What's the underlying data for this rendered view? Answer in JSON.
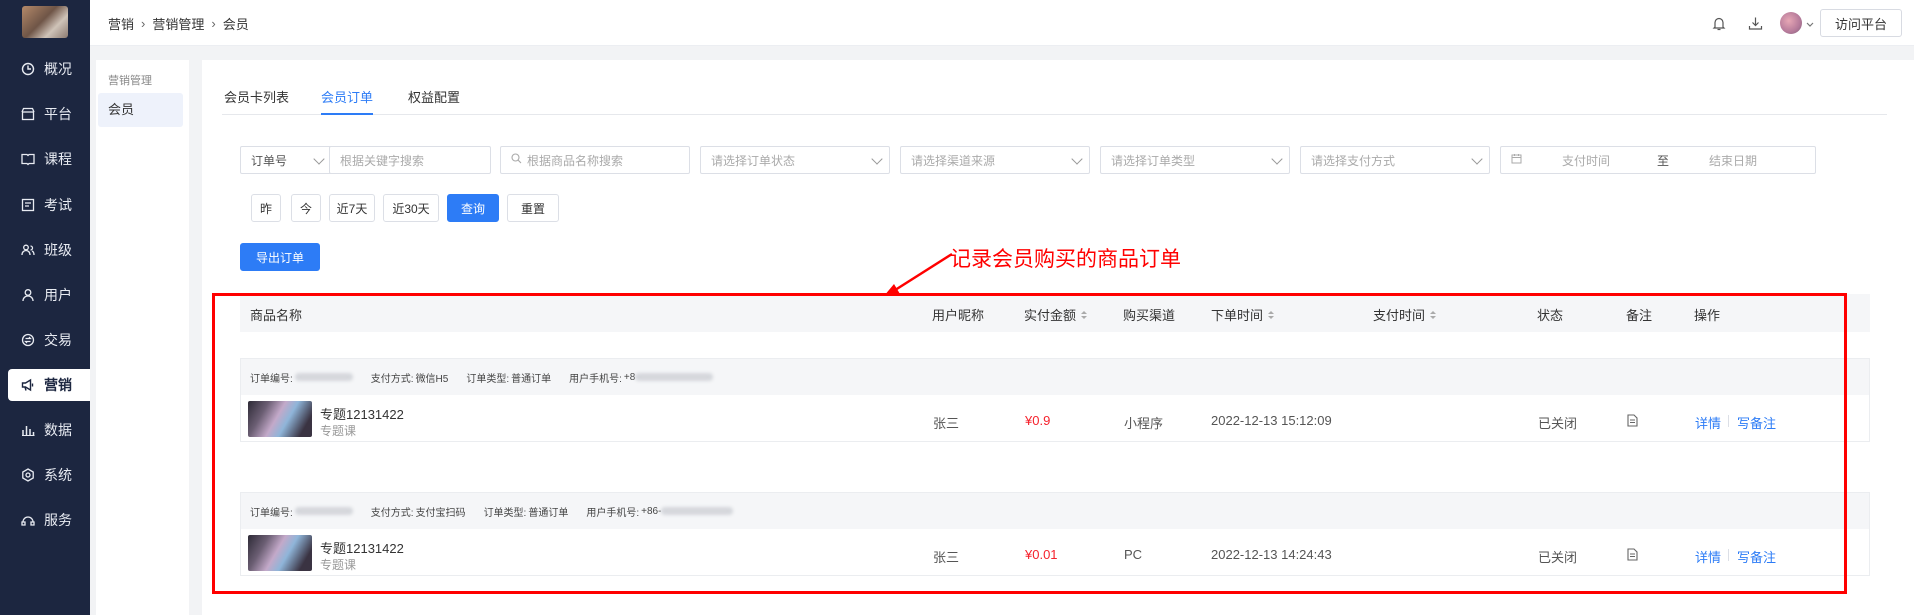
{
  "nav": {
    "items": [
      {
        "label": "概况",
        "icon": "clock-icon"
      },
      {
        "label": "平台",
        "icon": "store-icon"
      },
      {
        "label": "课程",
        "icon": "book-icon"
      },
      {
        "label": "考试",
        "icon": "exam-icon"
      },
      {
        "label": "班级",
        "icon": "class-icon"
      },
      {
        "label": "用户",
        "icon": "user-icon"
      },
      {
        "label": "交易",
        "icon": "trade-icon"
      },
      {
        "label": "营销",
        "icon": "megaphone-icon"
      },
      {
        "label": "数据",
        "icon": "bar-chart-icon"
      },
      {
        "label": "系统",
        "icon": "settings-icon"
      },
      {
        "label": "服务",
        "icon": "service-icon"
      }
    ],
    "active": "营销"
  },
  "header": {
    "breadcrumb": [
      "营销",
      "营销管理",
      "会员"
    ],
    "visit_button": "访问平台"
  },
  "subnav": {
    "group": "营销管理",
    "item": "会员"
  },
  "tabs": [
    "会员卡列表",
    "会员订单",
    "权益配置"
  ],
  "active_tab": "会员订单",
  "filters": {
    "order_type_select": "订单号",
    "keyword_placeholder": "根据关键字搜索",
    "product_placeholder": "根据商品名称搜索",
    "status_placeholder": "请选择订单状态",
    "channel_placeholder": "请选择渠道来源",
    "type_placeholder": "请选择订单类型",
    "payment_placeholder": "请选择支付方式",
    "start_placeholder": "支付时间",
    "range_sep": "至",
    "end_placeholder": "结束日期"
  },
  "quick_buttons": [
    "昨",
    "今",
    "近7天",
    "近30天"
  ],
  "query_button": "查询",
  "reset_button": "重置",
  "export_button": "导出订单",
  "annotation": "记录会员购买的商品订单",
  "table": {
    "headers": [
      "商品名称",
      "用户昵称",
      "实付金额",
      "购买渠道",
      "下单时间",
      "支付时间",
      "状态",
      "备注",
      "操作"
    ],
    "orders": [
      {
        "meta": {
          "order_no_label": "订单编号:",
          "pay_label": "支付方式:",
          "pay": "微信H5",
          "type_label": "订单类型:",
          "type": "普通订单",
          "phone_label": "用户手机号:",
          "phone_prefix": "+8"
        },
        "product": "专题12131422",
        "product_type": "专题课",
        "user": "张三",
        "amount": "¥0.9",
        "channel": "小程序",
        "order_time": "2022-12-13 15:12:09",
        "pay_time": "",
        "status": "已关闭",
        "actions": [
          "详情",
          "写备注"
        ]
      },
      {
        "meta": {
          "order_no_label": "订单编号:",
          "pay_label": "支付方式:",
          "pay": "支付宝扫码",
          "type_label": "订单类型:",
          "type": "普通订单",
          "phone_label": "用户手机号:",
          "phone_prefix": "+86-"
        },
        "product": "专题12131422",
        "product_type": "专题课",
        "user": "张三",
        "amount": "¥0.01",
        "channel": "PC",
        "order_time": "2022-12-13 14:24:43",
        "pay_time": "",
        "status": "已关闭",
        "actions": [
          "详情",
          "写备注"
        ]
      }
    ]
  },
  "colors": {
    "primary": "#2d7cf6",
    "nav_bg": "#1c2640",
    "price": "#f5222d",
    "highlight": "#ff0000"
  }
}
